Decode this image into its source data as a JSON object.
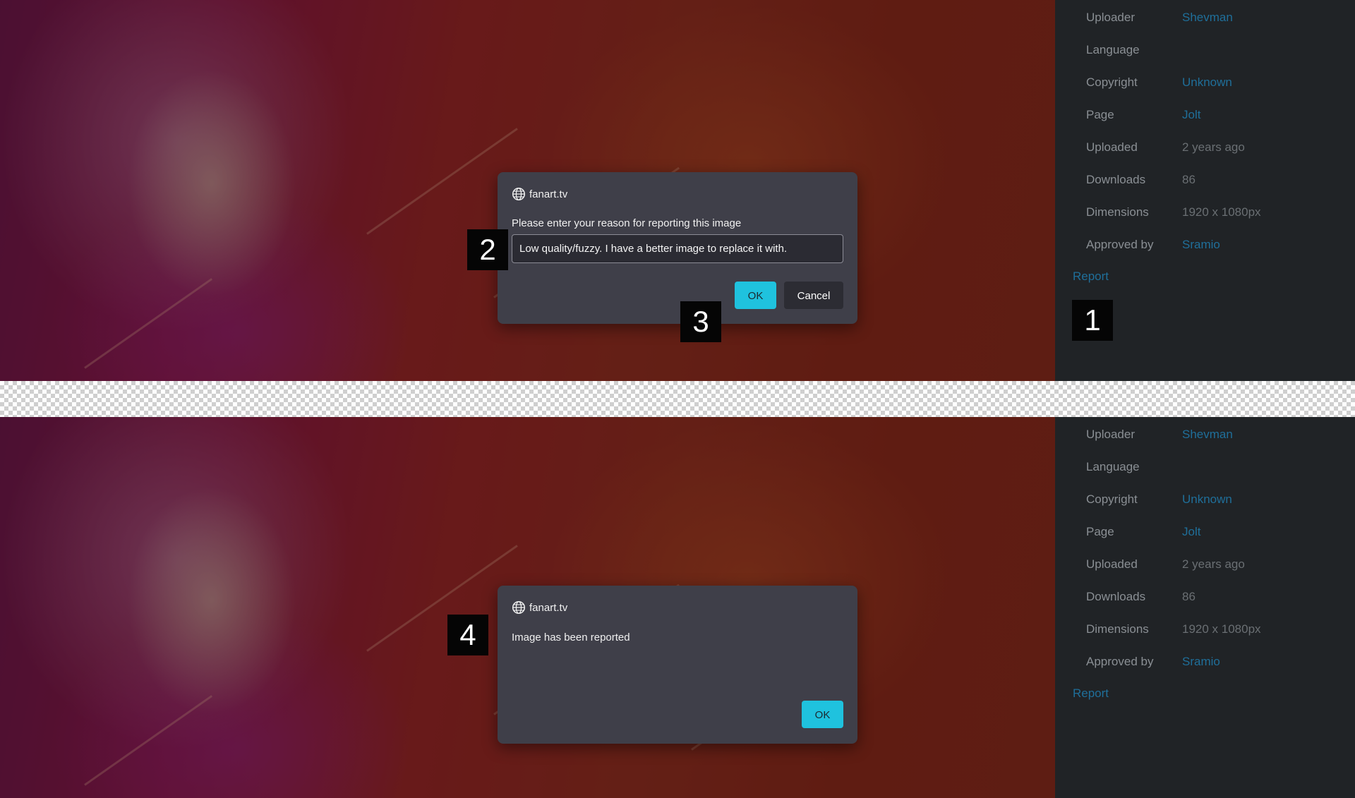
{
  "sidebar": {
    "rows": [
      {
        "label": "Uploader",
        "value": "Shevman"
      },
      {
        "label": "Language",
        "value": ""
      },
      {
        "label": "Copyright",
        "value": "Unknown"
      },
      {
        "label": "Page",
        "value": "Jolt"
      },
      {
        "label": "Uploaded",
        "value": "2 years ago"
      },
      {
        "label": "Downloads",
        "value": "86"
      },
      {
        "label": "Dimensions",
        "value": "1920 x 1080px"
      },
      {
        "label": "Approved by",
        "value": "Sramio"
      }
    ],
    "report_label": "Report",
    "link_color": "#1f6f9a"
  },
  "report_dialog": {
    "site": "fanart.tv",
    "icon": "globe-icon",
    "message": "Please enter your reason for reporting this image",
    "input_value": "Low quality/fuzzy. I have a better image to replace it with.",
    "ok_label": "OK",
    "cancel_label": "Cancel"
  },
  "confirm_dialog": {
    "site": "fanart.tv",
    "icon": "globe-icon",
    "message": "Image has been reported",
    "ok_label": "OK"
  },
  "markers": [
    "1",
    "2",
    "3",
    "4"
  ],
  "colors": {
    "accent": "#1fc2de",
    "dialog_bg": "#3f3f49",
    "sidebar_bg": "#202326"
  }
}
